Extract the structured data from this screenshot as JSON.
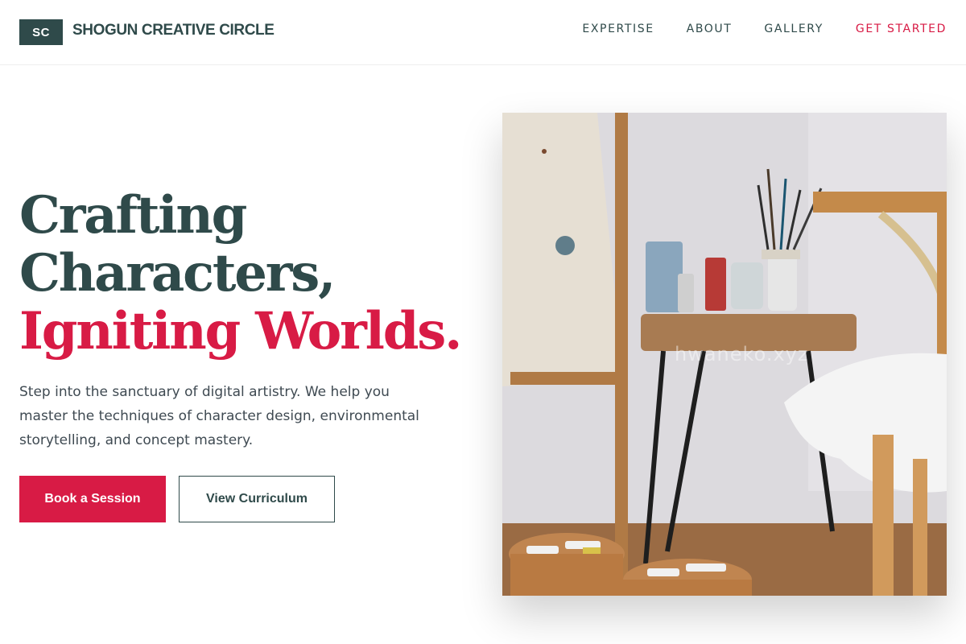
{
  "header": {
    "logo_initials": "SC",
    "brand_name": "SHOGUN CREATIVE CIRCLE",
    "nav": [
      {
        "label": "EXPERTISE"
      },
      {
        "label": "ABOUT"
      },
      {
        "label": "GALLERY"
      },
      {
        "label": "GET STARTED"
      }
    ]
  },
  "hero": {
    "headline_line1": "Crafting",
    "headline_line2": "Characters,",
    "headline_accent": "Igniting Worlds.",
    "description": "Step into the sanctuary of digital artistry. We help you master the techniques of character design, environmental storytelling, and concept mastery.",
    "primary_button": "Book a Session",
    "secondary_button": "View Curriculum",
    "image_watermark": "hwaneko.xyz"
  },
  "colors": {
    "brand_dark": "#2f4a4a",
    "accent": "#d81b45",
    "body_text": "#3f4a52"
  }
}
